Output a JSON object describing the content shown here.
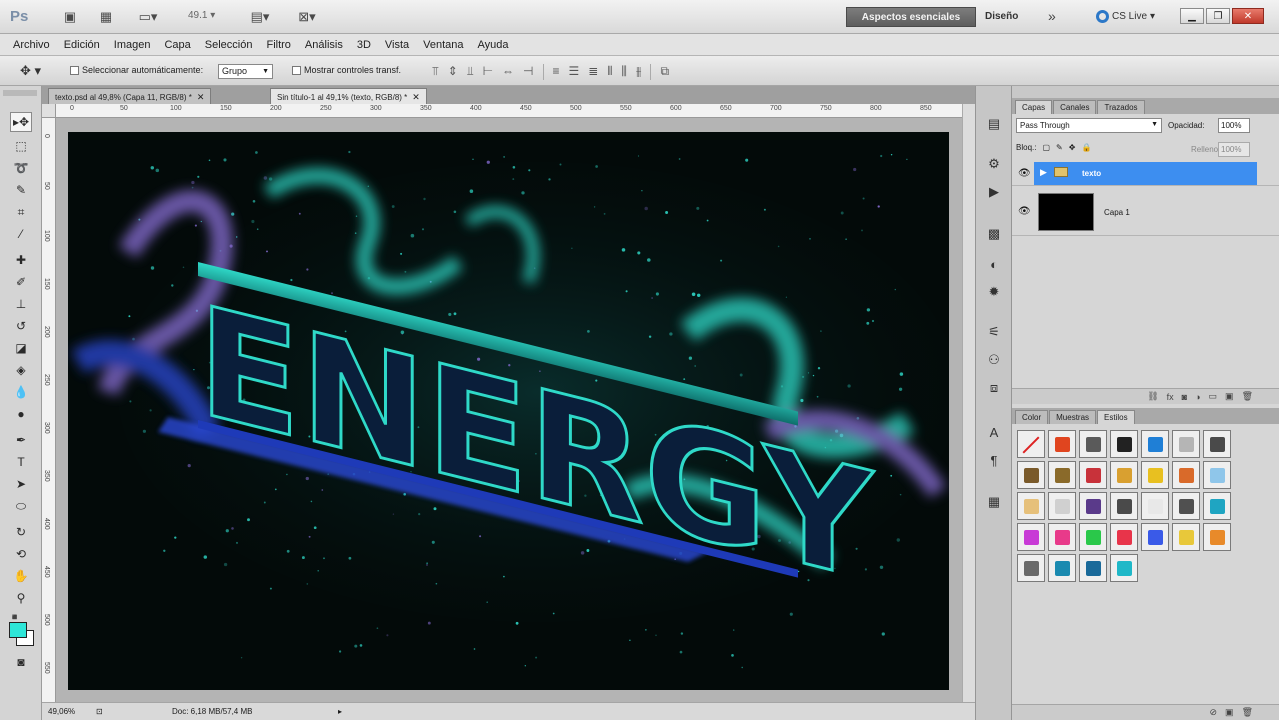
{
  "app": {
    "logo": "Ps",
    "zoom": "49.1",
    "workspace_active": "Aspectos esenciales",
    "workspace_other": "Diseño",
    "overflow": "»",
    "cslive": "CS Live"
  },
  "menu": [
    "Archivo",
    "Edición",
    "Imagen",
    "Capa",
    "Selección",
    "Filtro",
    "Análisis",
    "3D",
    "Vista",
    "Ventana",
    "Ayuda"
  ],
  "options": {
    "auto_select_label": "Seleccionar automáticamente:",
    "auto_select_value": "Grupo",
    "transform_label": "Mostrar controles transf."
  },
  "doc_tabs": [
    {
      "label": "texto.psd al 49,8% (Capa 11, RGB/8) *",
      "active": false
    },
    {
      "label": "Sin título-1 al 49,1% (texto, RGB/8) *",
      "active": true
    }
  ],
  "rulers": {
    "h": [
      "0",
      "50",
      "100",
      "150",
      "200",
      "250",
      "300",
      "350",
      "400",
      "450",
      "500",
      "550",
      "600",
      "650",
      "700",
      "750",
      "800",
      "850"
    ],
    "v": [
      "0",
      "50",
      "100",
      "150",
      "200",
      "250",
      "300",
      "350",
      "400",
      "450",
      "500",
      "550"
    ]
  },
  "artwork": {
    "text": "ENERGY",
    "colors": {
      "teal": "#2fd9c8",
      "violet": "#8a6fd8",
      "blue": "#2a49d6",
      "bg": "#030a09"
    }
  },
  "status": {
    "zoom": "49,06%",
    "doc": "Doc: 6,18 MB/57,4 MB"
  },
  "colors": {
    "foreground": "#2ee6d8",
    "background": "#ffffff",
    "selection": "#3d8ef0",
    "workspace_button": "#6b6b6b"
  },
  "layers_panel": {
    "tabs": [
      "Capas",
      "Canales",
      "Trazados"
    ],
    "blend_mode": "Pass Through",
    "opacity_label": "Opacidad:",
    "opacity": "100%",
    "lock_label": "Bloq.:",
    "fill_label": "Relleno:",
    "fill": "100%",
    "layers": [
      {
        "name": "texto",
        "type": "group",
        "selected": true
      },
      {
        "name": "Capa 1",
        "type": "pixel",
        "selected": false
      }
    ]
  },
  "styles_panel": {
    "tabs": [
      "Color",
      "Muestras",
      "Estilos"
    ],
    "swatches": [
      "#ffffff",
      "#e0451f",
      "#5a5a5a",
      "#222222",
      "#1f7fd6",
      "#b5b5b5",
      "#4a4a4a",
      "#7a5a2a",
      "#8a6a2a",
      "#c8323a",
      "#d9a030",
      "#e8c020",
      "#d96a2a",
      "#8fc6ea",
      "#e6c07a",
      "#d0d0d0",
      "#5a3a8a",
      "#4a4a4a",
      "#e8e8e8",
      "#505050",
      "#1fa5c2",
      "#c83ad6",
      "#e83a8a",
      "#2ac84a",
      "#e8344a",
      "#3a5ae8",
      "#e8c83a",
      "#e88a2a",
      "#6a6a6a",
      "#1a8ab0",
      "#1a6a9a",
      "#1fb8c8"
    ]
  }
}
